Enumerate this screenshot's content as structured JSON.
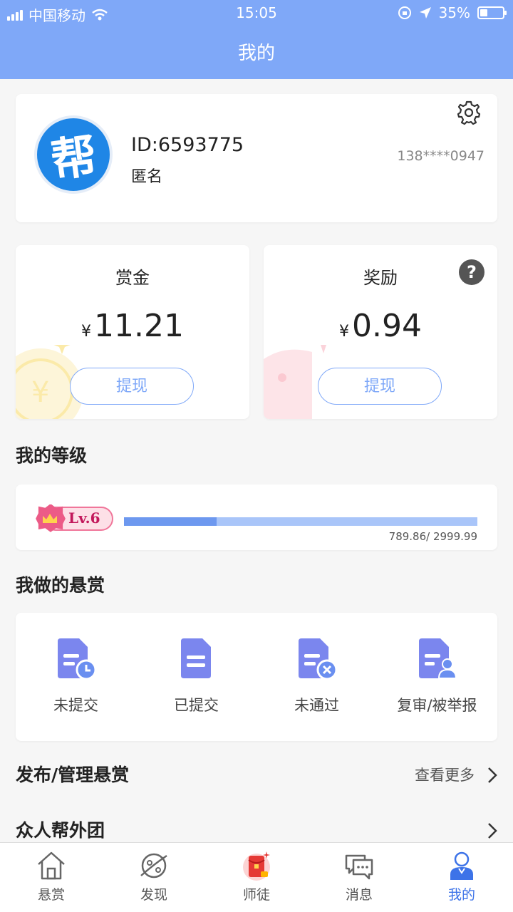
{
  "status_bar": {
    "carrier": "中国移动",
    "time": "15:05",
    "battery": "35%"
  },
  "header": {
    "title": "我的"
  },
  "profile": {
    "avatar_text": "帮",
    "id": "ID:6593775",
    "name": "匿名",
    "phone": "138****0947"
  },
  "bounty": {
    "title": "赏金",
    "currency": "¥",
    "amount": "11.21",
    "button": "提现"
  },
  "reward": {
    "title": "奖励",
    "currency": "¥",
    "amount": "0.94",
    "button": "提现",
    "help": "?"
  },
  "level": {
    "section_title": "我的等级",
    "badge": "Lv.6",
    "progress_text": "789.86/ 2999.99",
    "progress_fraction": 0.263
  },
  "tasks": {
    "section_title": "我做的悬赏",
    "items": [
      {
        "label": "未提交",
        "icon": "doc-clock-icon"
      },
      {
        "label": "已提交",
        "icon": "doc-icon"
      },
      {
        "label": "未通过",
        "icon": "doc-x-icon"
      },
      {
        "label": "复审/被举报",
        "icon": "doc-user-icon"
      }
    ]
  },
  "publish": {
    "title": "发布/管理悬赏",
    "more": "查看更多"
  },
  "outsource": {
    "title": "众人帮外团"
  },
  "tabs": [
    {
      "label": "悬赏",
      "icon": "home-icon"
    },
    {
      "label": "发现",
      "icon": "planet-icon"
    },
    {
      "label": "师徒",
      "icon": "red-envelope-icon"
    },
    {
      "label": "消息",
      "icon": "chat-icon"
    },
    {
      "label": "我的",
      "icon": "user-icon",
      "active": true
    }
  ],
  "colors": {
    "header": "#7fa8f8",
    "accent": "#3d73e8",
    "task_icon": "#7b86ee"
  }
}
